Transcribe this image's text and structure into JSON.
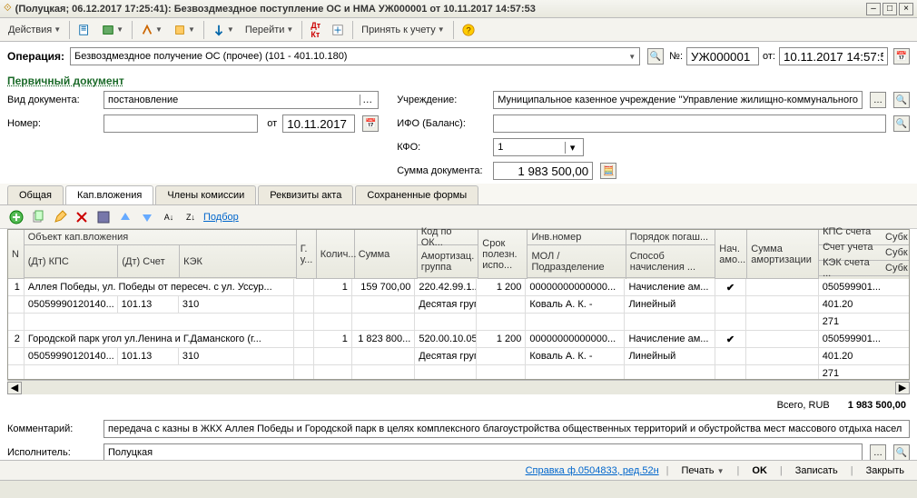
{
  "title": "(Полуцкая; 06.12.2017 17:25:41): Безвоздмездное поступление ОС и НМА УЖ000001 от 10.11.2017 14:57:53",
  "toolbar": {
    "actions": "Действия",
    "go": "Перейти",
    "accept": "Принять к учету"
  },
  "op": {
    "label": "Операция:",
    "value": "Безвоздмездное получение ОС (прочее) (101 - 401.10.180)",
    "num_lbl": "№:",
    "num": "УЖ000001",
    "from_lbl": "от:",
    "date": "10.11.2017 14:57:53"
  },
  "primary": {
    "title": "Первичный документ",
    "doc_type_lbl": "Вид документа:",
    "doc_type": "постановление",
    "number_lbl": "Номер:",
    "from_lbl": "от",
    "date": "10.11.2017"
  },
  "right": {
    "org_lbl": "Учреждение:",
    "org": "Муниципальное казенное учреждение ''Управление жилищно-коммунального",
    "ifo_lbl": "ИФО (Баланс):",
    "kfo_lbl": "КФО:",
    "kfo": "1",
    "sum_lbl": "Сумма документа:",
    "sum": "1 983 500,00"
  },
  "tabs": [
    "Общая",
    "Кап.вложения",
    "Члены комиссии",
    "Реквизиты акта",
    "Сохраненные формы"
  ],
  "tooltbar": {
    "podbor": "Подбор"
  },
  "grid": {
    "hdr": {
      "n": "N",
      "obj": "Объект кап.вложения",
      "dt_kps": "(Дт) КПС",
      "dt_sch": "(Дт) Счет",
      "kek": "КЭК",
      "gu": "Г. у...",
      "kol": "Колич...",
      "sum": "Сумма",
      "kod": "Код по ОК...",
      "amort": "Амортизац. группа",
      "srok": "Срок полезн. испо...",
      "inv": "Инв.номер",
      "mol": "МОЛ / Подразделение",
      "por": "Порядок погаш...",
      "sposob": "Способ начисления ...",
      "nach": "Нач. амо...",
      "sam": "Сумма амортизации",
      "kps_s": "КПС счета ...",
      "sch_u": "Счет учета ...",
      "kek_s": "КЭК счета ...",
      "sub": "Субк"
    },
    "rows": [
      {
        "n": "1",
        "obj": "Аллея Победы, ул. Победы от пересеч. с ул. Уссур...",
        "dt_kps": "05059990120140...",
        "dt_sch": "101.13",
        "kek": "310",
        "kol": "1",
        "sum": "159 700,00",
        "kod": "220.42.99.1...",
        "amort": "Десятая группа ...",
        "srok": "1 200",
        "inv": "00000000000000...",
        "mol": "Коваль А. К. -",
        "por": "Начисление ам...",
        "sposob": "Линейный",
        "nach": "✔",
        "kps_s": "050599901...",
        "sch_u": "401.20",
        "kek_s": "271"
      },
      {
        "n": "2",
        "obj": "Городской парк угол ул.Ленина и Г.Даманского (г...",
        "dt_kps": "05059990120140...",
        "dt_sch": "101.13",
        "kek": "310",
        "kol": "1",
        "sum": "1 823 800...",
        "kod": "520.00.10.05",
        "amort": "Десятая группа ...",
        "srok": "1 200",
        "inv": "00000000000000...",
        "mol": "Коваль А. К. -",
        "por": "Начисление ам...",
        "sposob": "Линейный",
        "nach": "✔",
        "kps_s": "050599901...",
        "sch_u": "401.20",
        "kek_s": "271"
      }
    ]
  },
  "total": {
    "lbl": "Всего, RUB",
    "val": "1 983 500,00"
  },
  "bottom": {
    "comment_lbl": "Комментарий:",
    "comment": "передача с казны в ЖКХ  Аллея Победы и Городской парк в целях комплексного благоустройства общественных территорий и обустройства мест массового отдыха насел",
    "exec_lbl": "Исполнитель:",
    "exec": "Полуцкая"
  },
  "status": {
    "ref": "Справка ф.0504833, ред.52н",
    "print": "Печать",
    "ok": "OK",
    "save": "Записать",
    "close": "Закрыть"
  }
}
